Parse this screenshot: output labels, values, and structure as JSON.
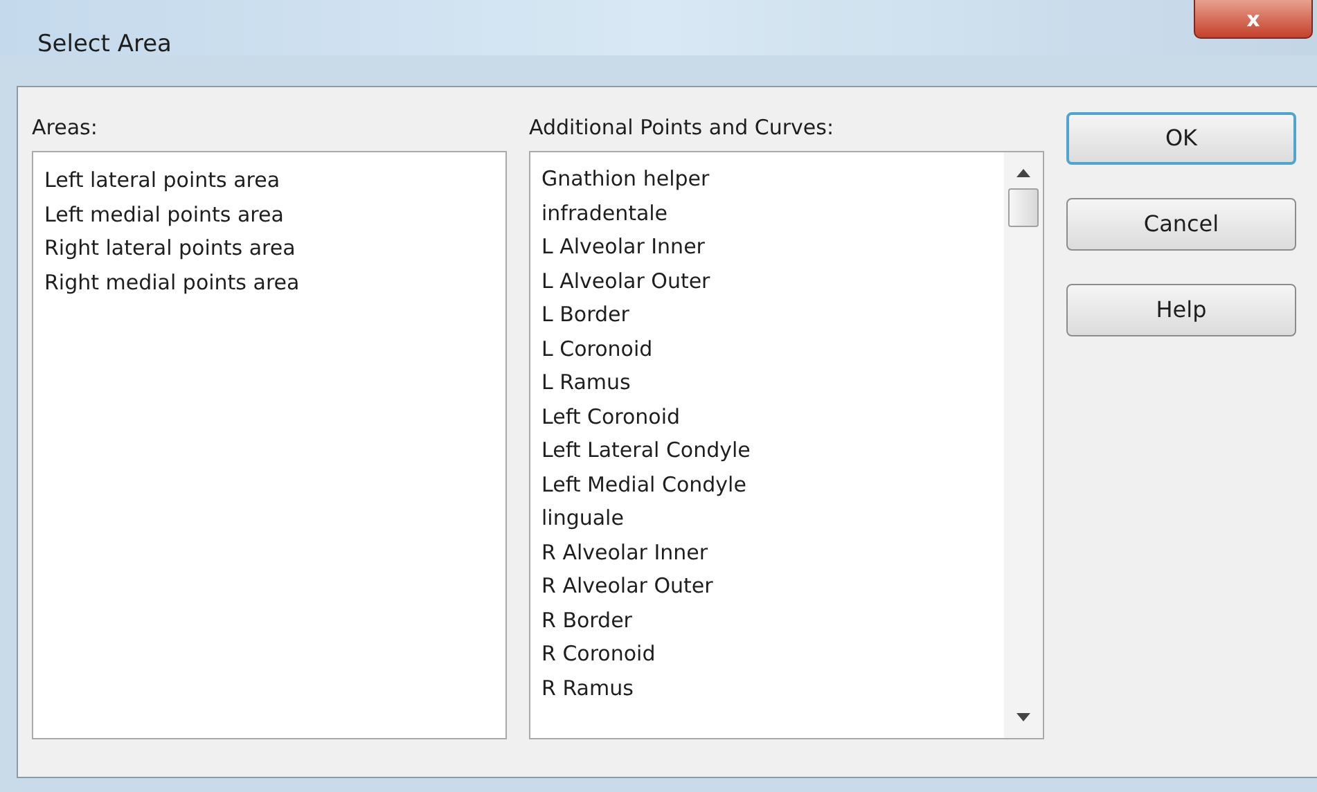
{
  "window": {
    "title": "Select Area",
    "close": "x"
  },
  "areas": {
    "label": "Areas:",
    "items": [
      "Left lateral points area",
      "Left medial points area",
      "Right lateral points area",
      "Right medial points area"
    ]
  },
  "additional": {
    "label": "Additional Points and Curves:",
    "items": [
      "Gnathion helper",
      "infradentale",
      "L Alveolar Inner",
      "L Alveolar Outer",
      "L Border",
      "L Coronoid",
      "L Ramus",
      "Left Coronoid",
      "Left Lateral Condyle",
      "Left Medial Condyle",
      "linguale",
      "R Alveolar Inner",
      "R Alveolar Outer",
      "R Border",
      "R Coronoid",
      "R Ramus"
    ]
  },
  "buttons": [
    {
      "label": "OK",
      "default": true
    },
    {
      "label": "Cancel",
      "default": false
    },
    {
      "label": "Help",
      "default": false
    }
  ]
}
